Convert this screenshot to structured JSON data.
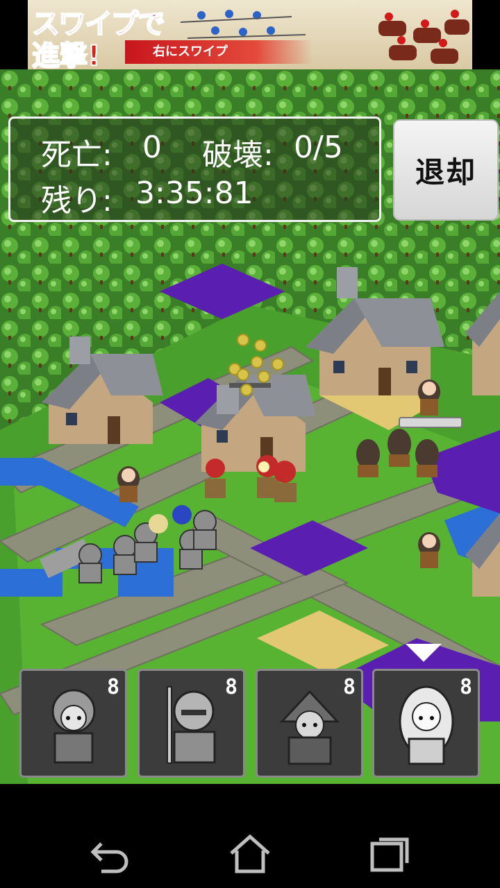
{
  "ad": {
    "headline_1": "スワイプで",
    "headline_2": "進撃!",
    "sub_caption": "右にスワイプ"
  },
  "hud": {
    "deaths_label": "死亡:",
    "deaths_value": "0",
    "destroyed_label": "破壊:",
    "destroyed_value": "0/5",
    "remaining_label": "残り:",
    "remaining_value": "3:35:81"
  },
  "retreat_button": {
    "label": "退却"
  },
  "unit_cards": [
    {
      "name": "swordsman-card",
      "cost": "8",
      "portrait_icon": "swordsman-portrait-icon"
    },
    {
      "name": "knight-card",
      "cost": "8",
      "portrait_icon": "armored-knight-portrait-icon"
    },
    {
      "name": "mage-card",
      "cost": "8",
      "portrait_icon": "hooded-mage-portrait-icon"
    },
    {
      "name": "priestess-card",
      "cost": "8",
      "portrait_icon": "priestess-portrait-icon"
    }
  ],
  "nav": {
    "back_icon": "back-arrow-icon",
    "home_icon": "home-icon",
    "recents_icon": "recent-apps-icon"
  },
  "colors": {
    "grass": "#3d8a2a",
    "road": "#8d8f7a",
    "water": "#2c6fd6",
    "poison": "#5a1fb0",
    "sand": "#e2c873",
    "hud_border": "#f4f4f4",
    "ad_red": "#d2261c"
  }
}
